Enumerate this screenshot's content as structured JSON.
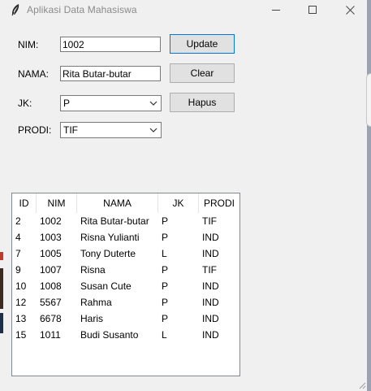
{
  "window": {
    "title": "Aplikasi Data Mahasiswa",
    "icon": "feather-icon",
    "controls": [
      "minimize-icon",
      "maximize-icon",
      "close-icon"
    ]
  },
  "form": {
    "nim_label": "NIM:",
    "nim_value": "1002",
    "nama_label": "NAMA:",
    "nama_value": "Rita Butar-butar",
    "jk_label": "JK:",
    "jk_value": "P",
    "prodi_label": "PRODI:",
    "prodi_value": "TIF"
  },
  "buttons": {
    "update": "Update",
    "clear": "Clear",
    "hapus": "Hapus"
  },
  "table": {
    "columns": [
      "ID",
      "NIM",
      "NAMA",
      "JK",
      "PRODI"
    ],
    "rows": [
      [
        "2",
        "1002",
        "Rita Butar-butar",
        "P",
        "TIF"
      ],
      [
        "4",
        "1003",
        "Risna Yulianti",
        "P",
        "IND"
      ],
      [
        "7",
        "1005",
        "Tony Duterte",
        "L",
        "IND"
      ],
      [
        "9",
        "1007",
        "Risna",
        "P",
        "TIF"
      ],
      [
        "10",
        "1008",
        "Susan Cute",
        "P",
        "IND"
      ],
      [
        "12",
        "5567",
        "Rahma",
        "P",
        "IND"
      ],
      [
        "13",
        "6678",
        "Haris",
        "P",
        "IND"
      ],
      [
        "15",
        "1011",
        "Budi Susanto",
        "L",
        "IND"
      ]
    ]
  }
}
